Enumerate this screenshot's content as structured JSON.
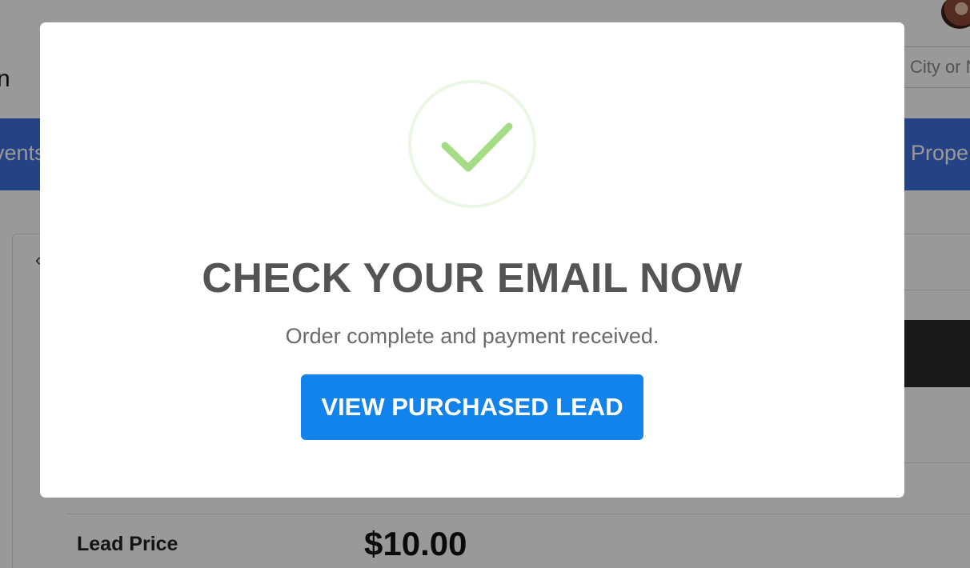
{
  "background": {
    "header_partial_text": "n",
    "search": {
      "placeholder": "City or Neighborhood"
    },
    "nav": {
      "left_partial": "vents",
      "right_partial": "Prope"
    },
    "back_caret": "‹",
    "lead_price_label": "Lead Price",
    "lead_price_value": "$10.00"
  },
  "modal": {
    "icon": "success-check-icon",
    "title": "CHECK YOUR EMAIL NOW",
    "text": "Order complete and payment received.",
    "button_label": "VIEW PURCHASED LEAD"
  },
  "colors": {
    "nav_bg": "#3f6fdc",
    "success_green": "#a5dc86",
    "button_blue": "#1383ec",
    "overlay": "rgba(0,0,0,0.4)"
  }
}
